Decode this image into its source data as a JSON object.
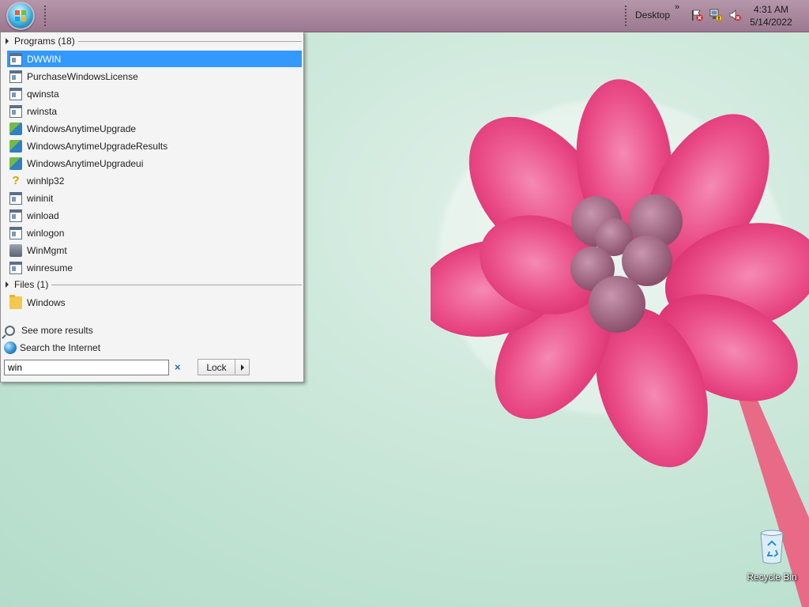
{
  "taskbar": {
    "start_icon": "windows-orb",
    "desktop_label": "Desktop",
    "chevron": "»",
    "tray_icons": [
      "action-center-flag-icon",
      "network-icon",
      "volume-muted-icon"
    ],
    "clock": {
      "time": "4:31 AM",
      "date": "5/14/2022"
    }
  },
  "start_menu": {
    "sections": {
      "programs": {
        "header": "Programs (18)"
      },
      "files": {
        "header": "Files (1)"
      }
    },
    "programs": [
      {
        "label": "DWWIN",
        "icon": "exe",
        "selected": true
      },
      {
        "label": "PurchaseWindowsLicense",
        "icon": "exe"
      },
      {
        "label": "qwinsta",
        "icon": "exe"
      },
      {
        "label": "rwinsta",
        "icon": "exe"
      },
      {
        "label": "WindowsAnytimeUpgrade",
        "icon": "upgrade"
      },
      {
        "label": "WindowsAnytimeUpgradeResults",
        "icon": "upgrade"
      },
      {
        "label": "WindowsAnytimeUpgradeui",
        "icon": "upgrade"
      },
      {
        "label": "winhlp32",
        "icon": "help"
      },
      {
        "label": "wininit",
        "icon": "exe"
      },
      {
        "label": "winload",
        "icon": "exe"
      },
      {
        "label": "winlogon",
        "icon": "exe"
      },
      {
        "label": "WinMgmt",
        "icon": "mgmt"
      },
      {
        "label": "winresume",
        "icon": "exe"
      }
    ],
    "files": [
      {
        "label": "Windows",
        "icon": "folder"
      }
    ],
    "see_more": "See more results",
    "search_internet": "Search the Internet",
    "search_value": "win",
    "clear_glyph": "×",
    "lock_label": "Lock"
  },
  "desktop": {
    "recycle_bin_label": "Recycle Bin"
  },
  "colors": {
    "selection": "#3399ff",
    "taskbar": "#a78399",
    "desktop_bg": "#c8e6d8",
    "petal": "#e9457f"
  }
}
